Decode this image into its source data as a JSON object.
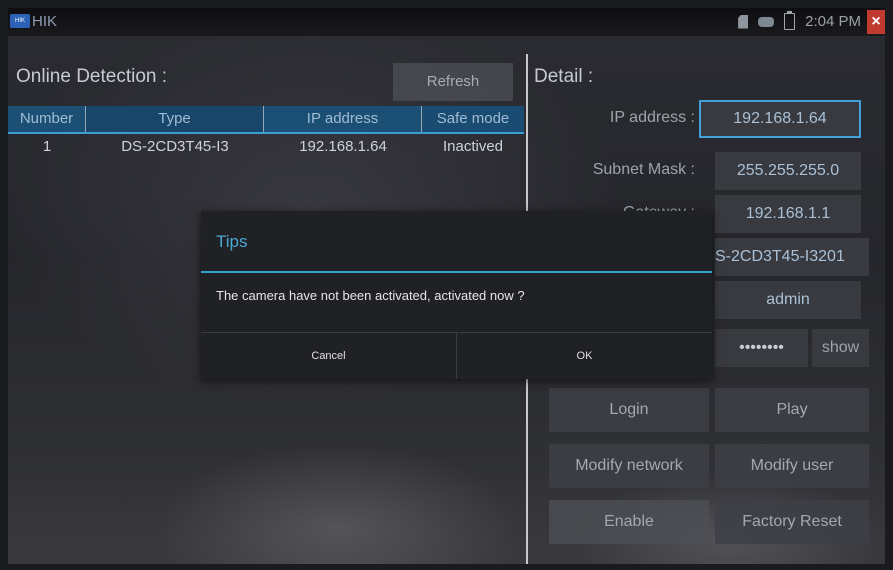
{
  "statusbar": {
    "app_badge": "HIK",
    "app_name": "HIK",
    "time": "2:04 PM",
    "close": "×"
  },
  "left": {
    "title": "Online Detection :",
    "refresh_label": "Refresh",
    "columns": [
      "Number",
      "Type",
      "IP address",
      "Safe mode"
    ],
    "rows": [
      {
        "number": "1",
        "type": "DS-2CD3T45-I3",
        "ip": "192.168.1.64",
        "safe_mode": "Inactived"
      }
    ]
  },
  "detail": {
    "title": "Detail :",
    "ip_label": "IP address :",
    "ip_value": "192.168.1.64",
    "subnet_label": "Subnet Mask :",
    "subnet_value": "255.255.255.0",
    "gateway_label": "Gateway :",
    "gateway_value": "192.168.1.1",
    "device_value": "S-2CD3T45-I3201",
    "user_value": "admin",
    "password_value": "••••••••",
    "show_label": "show",
    "buttons": {
      "login": "Login",
      "play": "Play",
      "modify_network": "Modify network",
      "modify_user": "Modify user",
      "enable": "Enable",
      "factory_reset": "Factory Reset"
    }
  },
  "dialog": {
    "title": "Tips",
    "message": "The camera have not been activated, activated now ?",
    "cancel": "Cancel",
    "ok": "OK"
  },
  "colors": {
    "accent": "#37a1d6",
    "header_bg": "#1c4f74",
    "close": "#c03a2f"
  }
}
